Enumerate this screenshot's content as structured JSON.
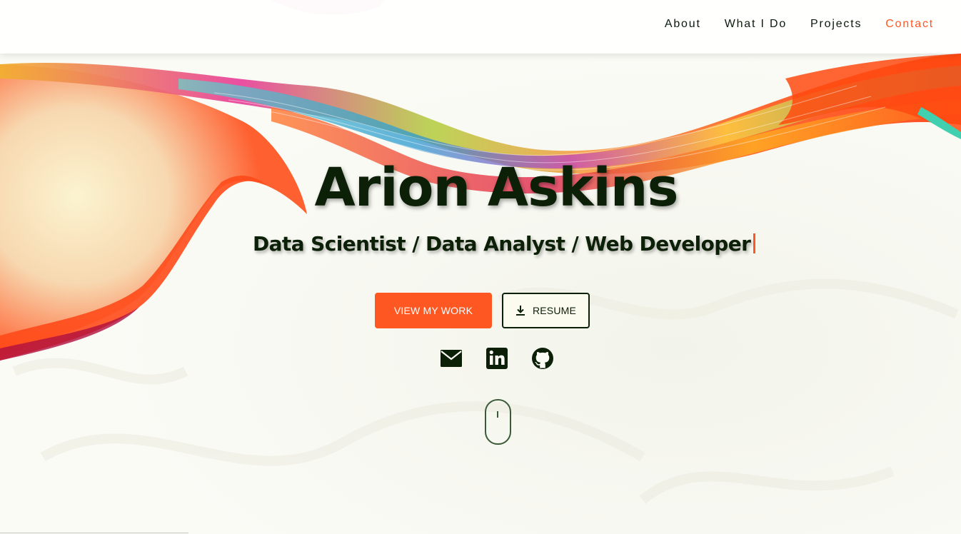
{
  "nav": {
    "items": [
      {
        "label": "About"
      },
      {
        "label": "What I Do"
      },
      {
        "label": "Projects"
      },
      {
        "label": "Contact"
      }
    ],
    "active_color": "#ff5722"
  },
  "hero": {
    "name": "Arion Askins",
    "subtitle": "Data Scientist / Data Analyst / Web Developer",
    "primary_button": "VIEW MY WORK",
    "resume_button": "RESUME"
  },
  "socials": [
    {
      "icon": "email-icon"
    },
    {
      "icon": "linkedin-icon"
    },
    {
      "icon": "github-icon"
    }
  ],
  "colors": {
    "accent": "#ff5722",
    "text_dark": "#0c1f07",
    "background": "#fbfbf6"
  }
}
